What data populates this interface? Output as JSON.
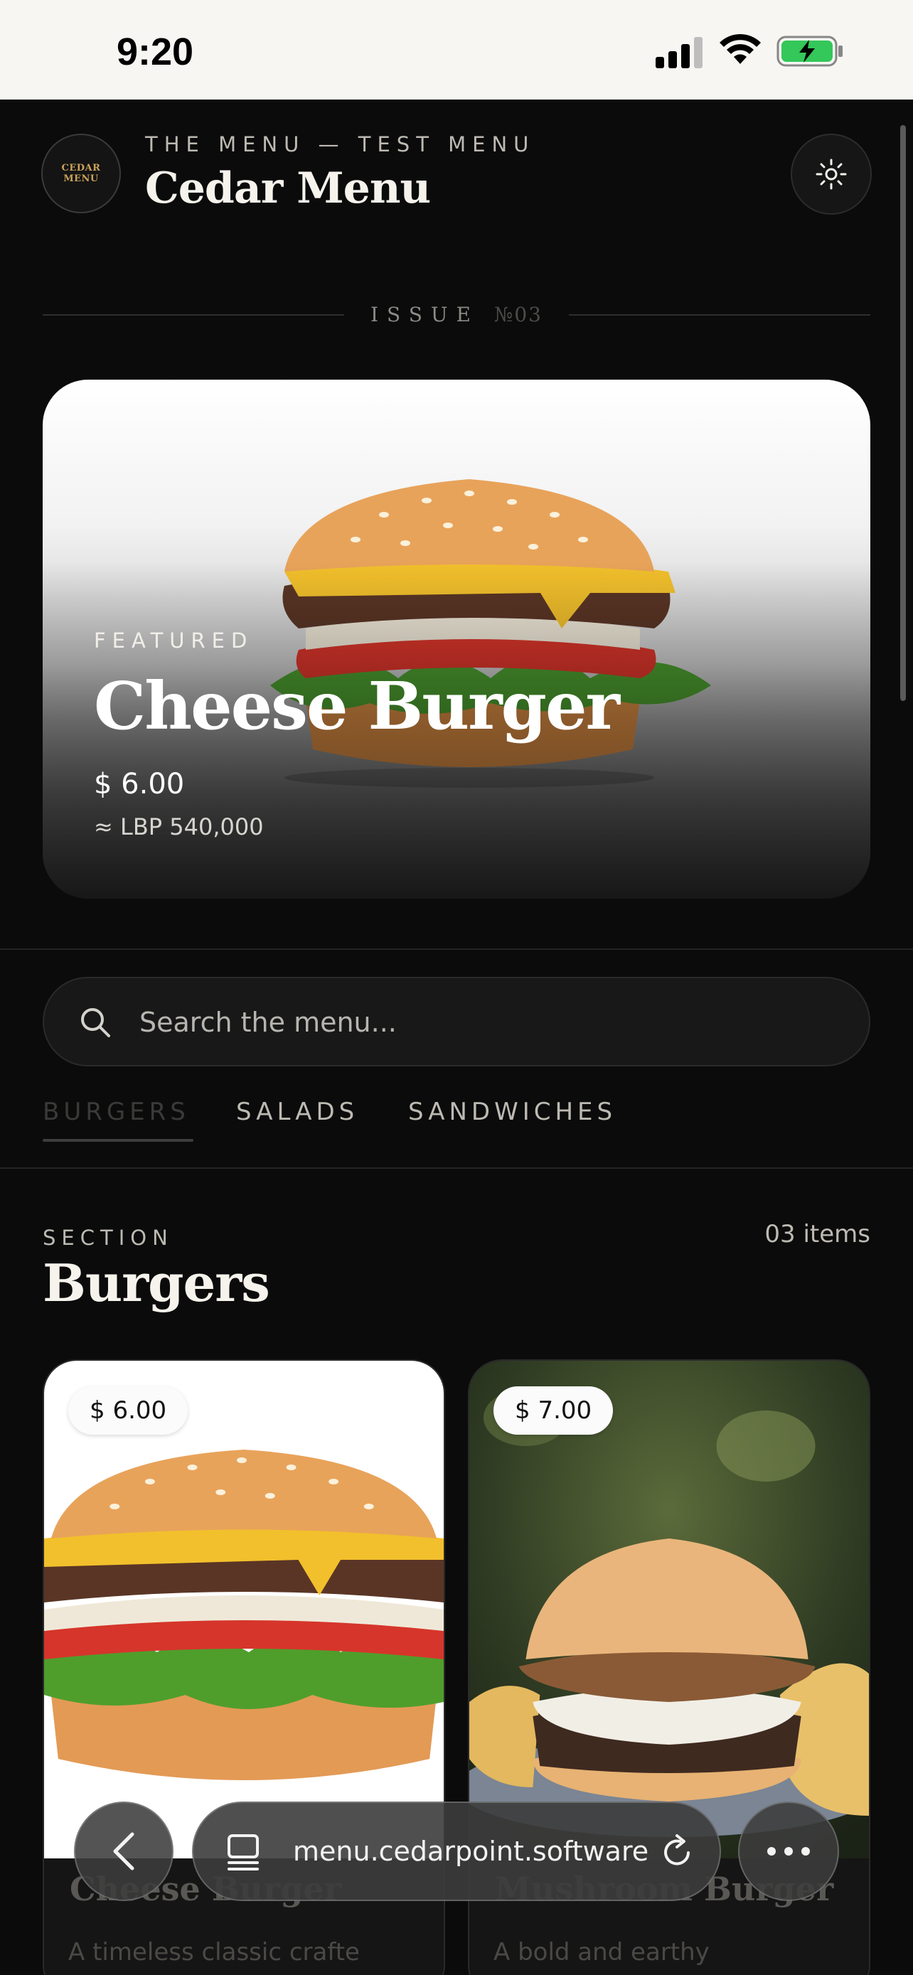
{
  "status_bar": {
    "time": "9:20"
  },
  "header": {
    "eyebrow": "THE MENU — TEST MENU",
    "title": "Cedar Menu",
    "logo_text": "CEDAR MENU"
  },
  "issue": {
    "label": "ISSUE",
    "number": "№03"
  },
  "featured": {
    "label": "FEATURED",
    "name": "Cheese Burger",
    "price": "$ 6.00",
    "price_alt": "≈ LBP 540,000"
  },
  "search": {
    "placeholder": "Search the menu..."
  },
  "tabs": [
    {
      "label": "BURGERS",
      "active": true
    },
    {
      "label": "SALADS",
      "active": false
    },
    {
      "label": "SANDWICHES",
      "active": false
    }
  ],
  "section": {
    "eyebrow": "SECTION",
    "title": "Burgers",
    "count": "03 items"
  },
  "items": [
    {
      "name": "Cheese Burger",
      "price": "$ 6.00",
      "description": "A timeless classic crafte"
    },
    {
      "name": "Mushroom Burger",
      "price": "$ 7.00",
      "description": "A bold and earthy"
    }
  ],
  "browser": {
    "url": "menu.cedarpoint.software"
  },
  "colors": {
    "background": "#0b0b0b",
    "text": "#f2f0eb",
    "muted": "#bdbab3",
    "logo_gold": "#c9a35a"
  }
}
